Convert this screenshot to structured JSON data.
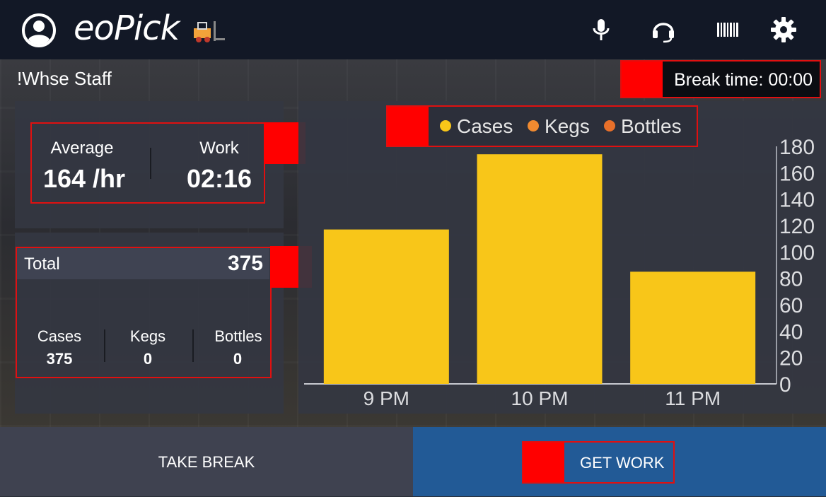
{
  "app": {
    "name": "eoPick"
  },
  "header": {
    "icons": [
      "account-circle-icon",
      "microphone-icon",
      "headset-icon",
      "barcode-icon",
      "settings-gear-icon"
    ]
  },
  "user": {
    "name": "!Whse Staff"
  },
  "break": {
    "text": "Break time: 00:00"
  },
  "rates": {
    "average_label": "Average",
    "average_value": "164 /hr",
    "work_label": "Work",
    "work_value": "02:16"
  },
  "totals": {
    "total_label": "Total",
    "total_value": "375",
    "items": [
      {
        "label": "Cases",
        "value": "375"
      },
      {
        "label": "Kegs",
        "value": "0"
      },
      {
        "label": "Bottles",
        "value": "0"
      }
    ]
  },
  "legend": [
    {
      "label": "Cases",
      "color": "#f8c619"
    },
    {
      "label": "Kegs",
      "color": "#f08a30"
    },
    {
      "label": "Bottles",
      "color": "#e8702a"
    }
  ],
  "chart_data": {
    "type": "bar",
    "categories": [
      "9 PM",
      "10 PM",
      "11 PM"
    ],
    "series": [
      {
        "name": "Cases",
        "values": [
          117,
          174,
          85
        ],
        "color": "#f8c619"
      },
      {
        "name": "Kegs",
        "values": [
          0,
          0,
          0
        ],
        "color": "#f08a30"
      },
      {
        "name": "Bottles",
        "values": [
          0,
          0,
          0
        ],
        "color": "#e8702a"
      }
    ],
    "ylim": [
      0,
      180
    ],
    "yticks": [
      0,
      20,
      40,
      60,
      80,
      100,
      120,
      140,
      160,
      180
    ],
    "y_axis_side": "right",
    "legend_position": "top"
  },
  "buttons": {
    "take_break": "TAKE BREAK",
    "get_work": "GET WORK"
  },
  "colors": {
    "topbar": "#121826",
    "accent_button": "#225a96",
    "highlight": "#ff0000"
  }
}
